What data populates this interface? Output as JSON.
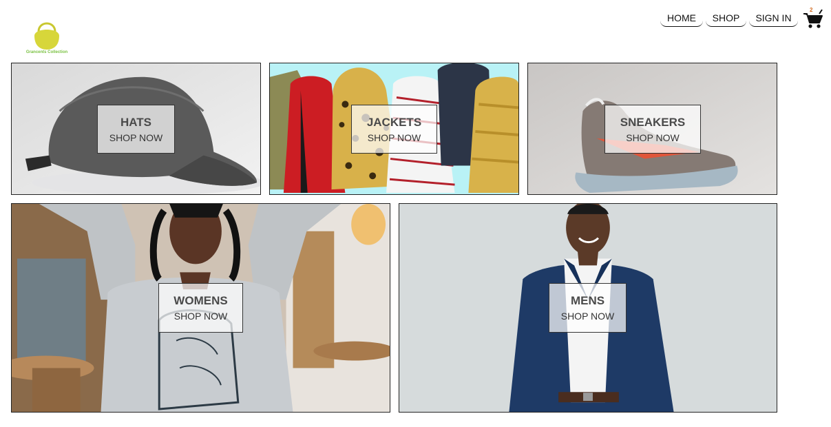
{
  "brand": {
    "name": "Grancents Collection",
    "logo_icon": "handbag-icon",
    "logo_color": "#d7d63a",
    "text_color": "#7ac142"
  },
  "nav": {
    "items": [
      "HOME",
      "SHOP",
      "SIGN IN"
    ]
  },
  "cart": {
    "icon": "shopping-cart-icon",
    "count": "2"
  },
  "categories": [
    {
      "title": "HATS",
      "cta": "SHOP NOW"
    },
    {
      "title": "JACKETS",
      "cta": "SHOP NOW"
    },
    {
      "title": "SNEAKERS",
      "cta": "SHOP NOW"
    },
    {
      "title": "WOMENS",
      "cta": "SHOP NOW"
    },
    {
      "title": "MENS",
      "cta": "SHOP NOW"
    }
  ]
}
